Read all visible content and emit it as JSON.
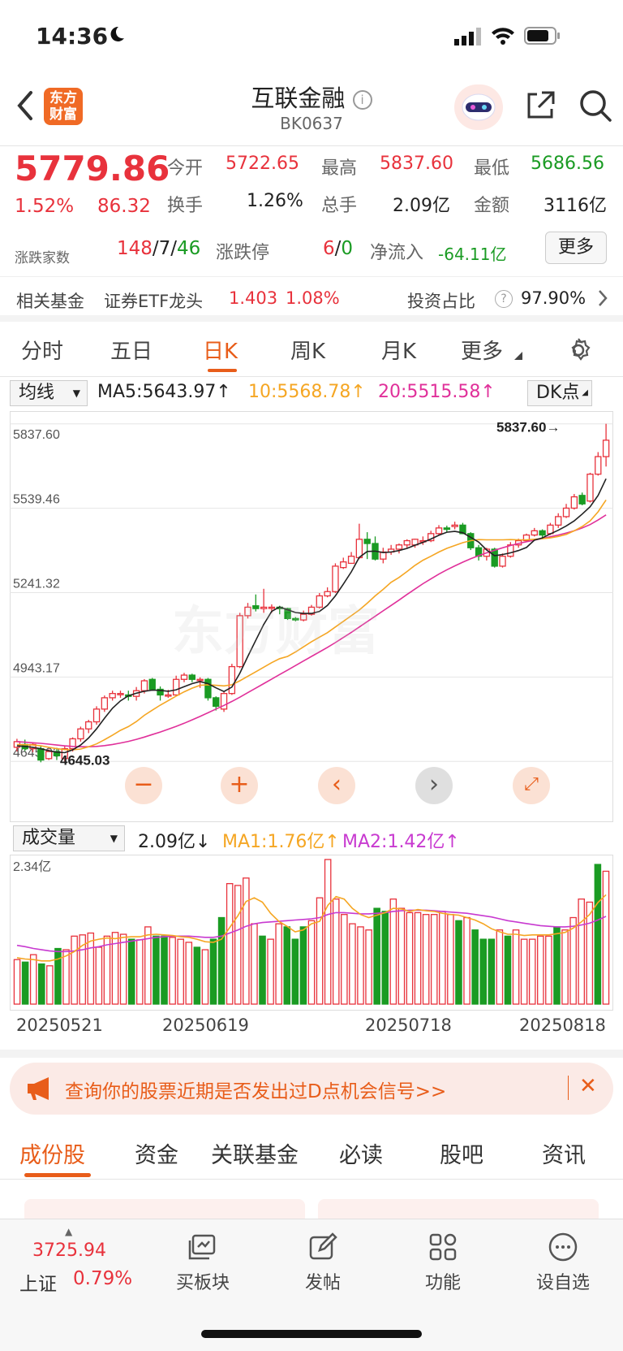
{
  "status": {
    "time": "14:36"
  },
  "nav": {
    "logo_line1": "东方",
    "logo_line2": "财富",
    "title": "互联金融",
    "code": "BK0637"
  },
  "quote": {
    "price": "5779.86",
    "pct": "1.52%",
    "chg": "86.32",
    "open_label": "今开",
    "open": "5722.65",
    "high_label": "最高",
    "high": "5837.60",
    "low_label": "最低",
    "low": "5686.56",
    "turnover_label": "换手",
    "turnover": "1.26%",
    "volume_label": "总手",
    "volume": "2.09亿",
    "amount_label": "金额",
    "amount": "3116亿",
    "breadth_label": "涨跌家数",
    "up": "148",
    "flat": "7",
    "down": "46",
    "limit_label": "涨跌停",
    "limit_up": "6",
    "limit_down": "0",
    "inflow_label": "净流入",
    "inflow": "-64.11亿",
    "more": "更多"
  },
  "fund": {
    "label": "相关基金",
    "name": "证券ETF龙头",
    "price": "1.403",
    "pct": "1.08%",
    "ratio_label": "投资占比",
    "ratio": "97.90%"
  },
  "tabs": [
    "分时",
    "五日",
    "日K",
    "周K",
    "月K",
    "更多"
  ],
  "indicators": {
    "ma_select": "均线",
    "ma5": "MA5:5643.97↑",
    "ma10": "10:5568.78↑",
    "ma20": "20:5515.58↑",
    "dk": "DK点",
    "vol_select": "成交量",
    "vol": "2.09亿↓",
    "vma1": "MA1:1.76亿↑",
    "vma2": "MA2:1.42亿↑"
  },
  "colors": {
    "up": "#e8323c",
    "down": "#1a9b23",
    "ma5": "#222222",
    "ma10": "#f5a623",
    "ma20": "#e0309a",
    "accent": "#e85d1a"
  },
  "chart_data": {
    "type": "candlestick",
    "y_ticks": [
      "5837.60",
      "5539.46",
      "5241.32",
      "4943.17",
      "4645.03"
    ],
    "ylim": [
      4620,
      5860
    ],
    "max_label": "5837.60→",
    "min_label": "4645.03",
    "x_ticks": [
      "20250521",
      "20250619",
      "20250718",
      "20250818"
    ],
    "vol_max_label": "2.34亿",
    "vol_max": 2.34,
    "candles": [
      [
        4695,
        4715,
        4680,
        4725
      ],
      [
        4705,
        4690,
        4682,
        4722
      ],
      [
        4690,
        4705,
        4678,
        4712
      ],
      [
        4690,
        4650,
        4642,
        4702
      ],
      [
        4655,
        4680,
        4650,
        4688
      ],
      [
        4680,
        4665,
        4650,
        4690
      ],
      [
        4655,
        4690,
        4645,
        4700
      ],
      [
        4690,
        4725,
        4680,
        4730
      ],
      [
        4725,
        4760,
        4715,
        4768
      ],
      [
        4760,
        4785,
        4745,
        4792
      ],
      [
        4785,
        4830,
        4775,
        4840
      ],
      [
        4830,
        4870,
        4820,
        4878
      ],
      [
        4870,
        4885,
        4860,
        4895
      ],
      [
        4885,
        4885,
        4870,
        4895
      ],
      [
        4880,
        4875,
        4860,
        4895
      ],
      [
        4875,
        4895,
        4860,
        4908
      ],
      [
        4895,
        4930,
        4885,
        4936
      ],
      [
        4935,
        4900,
        4895,
        4940
      ],
      [
        4900,
        4880,
        4860,
        4910
      ],
      [
        4880,
        4880,
        4870,
        4898
      ],
      [
        4880,
        4935,
        4875,
        4948
      ],
      [
        4935,
        4950,
        4925,
        4958
      ],
      [
        4950,
        4935,
        4925,
        4955
      ],
      [
        4935,
        4935,
        4905,
        4942
      ],
      [
        4935,
        4870,
        4860,
        4940
      ],
      [
        4870,
        4840,
        4825,
        4875
      ],
      [
        4830,
        4885,
        4820,
        4890
      ],
      [
        4885,
        4980,
        4880,
        4990
      ],
      [
        4980,
        5160,
        4975,
        5170
      ],
      [
        5160,
        5190,
        5150,
        5205
      ],
      [
        5195,
        5185,
        5175,
        5235
      ],
      [
        5185,
        5190,
        5170,
        5255
      ],
      [
        5190,
        5190,
        5170,
        5200
      ],
      [
        5190,
        5185,
        5165,
        5195
      ],
      [
        5185,
        5150,
        5145,
        5188
      ],
      [
        5150,
        5145,
        5140,
        5155
      ],
      [
        5145,
        5165,
        5140,
        5178
      ],
      [
        5165,
        5190,
        5160,
        5198
      ],
      [
        5190,
        5230,
        5185,
        5240
      ],
      [
        5230,
        5245,
        5225,
        5260
      ],
      [
        5245,
        5335,
        5240,
        5345
      ],
      [
        5330,
        5350,
        5325,
        5365
      ],
      [
        5345,
        5370,
        5345,
        5385
      ],
      [
        5365,
        5430,
        5360,
        5485
      ],
      [
        5430,
        5415,
        5360,
        5455
      ],
      [
        5415,
        5360,
        5355,
        5440
      ],
      [
        5360,
        5385,
        5345,
        5400
      ],
      [
        5385,
        5395,
        5375,
        5410
      ],
      [
        5395,
        5410,
        5380,
        5415
      ],
      [
        5410,
        5425,
        5400,
        5430
      ],
      [
        5410,
        5430,
        5400,
        5432
      ],
      [
        5425,
        5425,
        5410,
        5440
      ],
      [
        5425,
        5450,
        5420,
        5460
      ],
      [
        5450,
        5470,
        5445,
        5480
      ],
      [
        5470,
        5465,
        5455,
        5478
      ],
      [
        5475,
        5480,
        5465,
        5492
      ],
      [
        5480,
        5450,
        5448,
        5488
      ],
      [
        5450,
        5400,
        5392,
        5455
      ],
      [
        5400,
        5370,
        5355,
        5410
      ],
      [
        5370,
        5395,
        5355,
        5400
      ],
      [
        5395,
        5335,
        5330,
        5400
      ],
      [
        5335,
        5370,
        5330,
        5380
      ],
      [
        5370,
        5410,
        5365,
        5420
      ],
      [
        5410,
        5425,
        5400,
        5432
      ],
      [
        5425,
        5445,
        5420,
        5450
      ],
      [
        5445,
        5460,
        5440,
        5470
      ],
      [
        5460,
        5445,
        5430,
        5465
      ],
      [
        5450,
        5480,
        5445,
        5488
      ],
      [
        5480,
        5510,
        5470,
        5522
      ],
      [
        5510,
        5540,
        5505,
        5555
      ],
      [
        5540,
        5580,
        5535,
        5590
      ],
      [
        5585,
        5555,
        5550,
        5595
      ],
      [
        5565,
        5660,
        5560,
        5665
      ],
      [
        5660,
        5722,
        5655,
        5738
      ],
      [
        5722,
        5780,
        5687,
        5838
      ]
    ],
    "volumes": [
      0.72,
      0.68,
      0.8,
      0.65,
      0.62,
      0.9,
      0.88,
      1.1,
      1.12,
      1.15,
      0.92,
      1.1,
      1.16,
      1.13,
      1.05,
      1.04,
      1.25,
      1.1,
      1.1,
      1.08,
      1.05,
      1.0,
      0.92,
      0.88,
      1.05,
      1.4,
      1.95,
      1.92,
      2.04,
      1.3,
      1.1,
      1.05,
      1.3,
      1.25,
      1.05,
      1.25,
      1.35,
      1.72,
      2.34,
      1.7,
      1.45,
      1.3,
      1.25,
      1.2,
      1.55,
      1.5,
      1.7,
      1.55,
      1.48,
      1.48,
      1.45,
      1.45,
      1.5,
      1.45,
      1.35,
      1.4,
      1.2,
      1.05,
      1.05,
      1.2,
      1.1,
      1.2,
      1.05,
      1.05,
      1.1,
      1.1,
      1.25,
      1.2,
      1.4,
      1.7,
      1.65,
      2.26,
      2.15
    ],
    "ma5": [
      4700,
      4698,
      4695,
      4690,
      4683,
      4678,
      4676,
      4686,
      4703,
      4728,
      4760,
      4798,
      4833,
      4859,
      4877,
      4886,
      4893,
      4897,
      4896,
      4893,
      4898,
      4909,
      4920,
      4927,
      4920,
      4905,
      4892,
      4908,
      4957,
      5016,
      5073,
      5129,
      5175,
      5191,
      5181,
      5171,
      5168,
      5168,
      5175,
      5196,
      5230,
      5272,
      5315,
      5366,
      5387,
      5388,
      5383,
      5385,
      5390,
      5398,
      5409,
      5419,
      5431,
      5444,
      5455,
      5458,
      5453,
      5437,
      5420,
      5392,
      5372,
      5376,
      5382,
      5390,
      5401,
      5427,
      5435,
      5449,
      5462,
      5477,
      5495,
      5519,
      5545,
      5585,
      5644
    ],
    "ma10": [
      4705,
      4704,
      4703,
      4700,
      4695,
      4690,
      4687,
      4686,
      4689,
      4697,
      4707,
      4722,
      4738,
      4755,
      4768,
      4786,
      4808,
      4826,
      4844,
      4860,
      4876,
      4891,
      4904,
      4914,
      4916,
      4914,
      4912,
      4916,
      4930,
      4946,
      4962,
      4978,
      4994,
      5008,
      5016,
      5032,
      5050,
      5068,
      5084,
      5100,
      5120,
      5140,
      5160,
      5180,
      5204,
      5230,
      5253,
      5278,
      5295,
      5316,
      5338,
      5356,
      5370,
      5385,
      5398,
      5408,
      5418,
      5425,
      5429,
      5428,
      5428,
      5428,
      5429,
      5428,
      5428,
      5430,
      5432,
      5435,
      5440,
      5447,
      5460,
      5475,
      5495,
      5527,
      5569
    ],
    "ma20": [
      4715,
      4713,
      4711,
      4709,
      4706,
      4703,
      4700,
      4698,
      4697,
      4697,
      4698,
      4701,
      4705,
      4710,
      4716,
      4723,
      4731,
      4740,
      4749,
      4759,
      4769,
      4780,
      4792,
      4804,
      4817,
      4830,
      4843,
      4857,
      4872,
      4888,
      4904,
      4920,
      4936,
      4952,
      4968,
      4984,
      5000,
      5016,
      5032,
      5048,
      5065,
      5083,
      5101,
      5120,
      5139,
      5158,
      5177,
      5196,
      5215,
      5235,
      5254,
      5273,
      5290,
      5307,
      5322,
      5336,
      5349,
      5361,
      5372,
      5382,
      5391,
      5400,
      5408,
      5415,
      5421,
      5427,
      5433,
      5439,
      5445,
      5452,
      5460,
      5470,
      5482,
      5498,
      5516
    ],
    "vma1": [
      0.75,
      0.73,
      0.72,
      0.7,
      0.7,
      0.73,
      0.78,
      0.85,
      0.95,
      1.02,
      1.05,
      1.07,
      1.06,
      1.08,
      1.09,
      1.09,
      1.12,
      1.13,
      1.12,
      1.11,
      1.09,
      1.08,
      1.05,
      1.01,
      1.0,
      1.05,
      1.24,
      1.43,
      1.66,
      1.72,
      1.65,
      1.47,
      1.34,
      1.26,
      1.17,
      1.2,
      1.3,
      1.34,
      1.6,
      1.74,
      1.7,
      1.55,
      1.45,
      1.4,
      1.44,
      1.48,
      1.55,
      1.54,
      1.5,
      1.53,
      1.51,
      1.5,
      1.47,
      1.45,
      1.44,
      1.4,
      1.36,
      1.3,
      1.22,
      1.17,
      1.13,
      1.13,
      1.11,
      1.12,
      1.12,
      1.12,
      1.14,
      1.16,
      1.23,
      1.33,
      1.45,
      1.64,
      1.77
    ],
    "vma2": [
      0.95,
      0.93,
      0.9,
      0.88,
      0.86,
      0.85,
      0.85,
      0.86,
      0.88,
      0.91,
      0.93,
      0.96,
      0.98,
      1.0,
      1.02,
      1.04,
      1.06,
      1.08,
      1.09,
      1.1,
      1.1,
      1.1,
      1.09,
      1.08,
      1.08,
      1.1,
      1.15,
      1.2,
      1.26,
      1.3,
      1.32,
      1.33,
      1.34,
      1.35,
      1.36,
      1.37,
      1.38,
      1.4,
      1.45,
      1.48,
      1.48,
      1.47,
      1.46,
      1.46,
      1.47,
      1.48,
      1.5,
      1.51,
      1.52,
      1.52,
      1.52,
      1.51,
      1.5,
      1.49,
      1.48,
      1.47,
      1.45,
      1.43,
      1.41,
      1.38,
      1.35,
      1.33,
      1.31,
      1.29,
      1.27,
      1.26,
      1.25,
      1.25,
      1.26,
      1.28,
      1.31,
      1.36,
      1.42
    ]
  },
  "banner": {
    "text": "查询你的股票近期是否发出过D点机会信号>>"
  },
  "subtabs": [
    "成份股",
    "资金",
    "关联基金",
    "必读",
    "股吧",
    "资讯"
  ],
  "bottom": {
    "index_value": "3725.94",
    "index_name": "上证",
    "index_pct": "0.79%",
    "items": [
      "买板块",
      "发帖",
      "功能",
      "设自选"
    ]
  }
}
